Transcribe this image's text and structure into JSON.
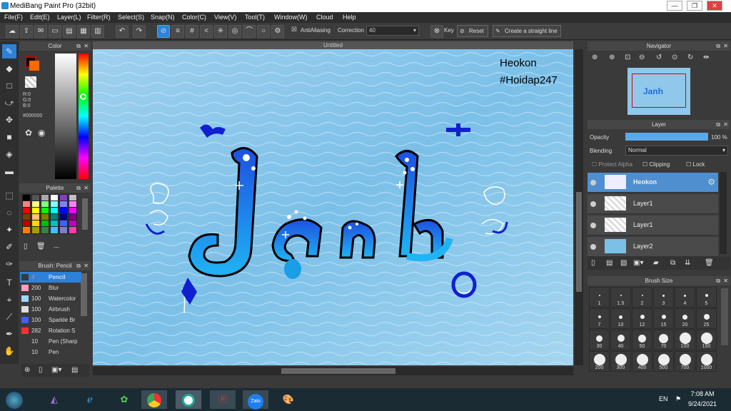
{
  "window": {
    "title": "MediBang Paint Pro (32bit)",
    "min": "—",
    "max": "❐",
    "close": "✕"
  },
  "menu": [
    "File(F)",
    "Edit(E)",
    "Layer(L)",
    "Filter(R)",
    "Select(S)",
    "Snap(N)",
    "Color(C)",
    "View(V)",
    "Tool(T)",
    "Window(W)",
    "Cloud",
    "Help"
  ],
  "toolbar": {
    "antialiasing": "AntiAliasing",
    "correction_label": "Correction",
    "correction_value": "40",
    "key": "Key",
    "reset": "Reset",
    "straight": "Create a straight line"
  },
  "color_panel": {
    "title": "Color",
    "r": "R:0",
    "g": "G:0",
    "b": "B:0",
    "hex": "#000000",
    "fg": "#000000",
    "bg": "#ff6a00"
  },
  "palette_panel": {
    "title": "Palette",
    "colors": [
      "#000000",
      "#555555",
      "#aaaaaa",
      "#ffffff",
      "#8040c0",
      "#c0c0c0",
      "#ff8080",
      "#ffff80",
      "#80ff80",
      "#80ffff",
      "#8080ff",
      "#ff80ff",
      "#ff0000",
      "#ffff00",
      "#00ff00",
      "#00ffff",
      "#0000ff",
      "#ff00ff",
      "#804000",
      "#ffc080",
      "#808000",
      "#008080",
      "#000080",
      "#800080",
      "#c00000",
      "#ffd700",
      "#00c000",
      "#00c0c0",
      "#4060ff",
      "#c000c0",
      "#ff8000",
      "#a0a000",
      "#408040",
      "#40c0ff",
      "#8080c0",
      "#ff40a0"
    ],
    "more": "---"
  },
  "brush_panel": {
    "title": "Brush: Pencil",
    "items": [
      {
        "size": "4",
        "name": "Pencil",
        "color": "#3a3a3a",
        "sel": true
      },
      {
        "size": "200",
        "name": "Blur",
        "color": "#ff9fc0"
      },
      {
        "size": "100",
        "name": "Watercolor",
        "color": "#9fd8ff"
      },
      {
        "size": "100",
        "name": "Airbrush",
        "color": "#dddddd"
      },
      {
        "size": "100",
        "name": "Sparkle Br",
        "color": "#4060ff"
      },
      {
        "size": "282",
        "name": "Rotation S",
        "color": "#ff3030"
      },
      {
        "size": "10",
        "name": "Pen (Sharp",
        "color": "#3a3a3a"
      },
      {
        "size": "10",
        "name": "Pen",
        "color": "#3a3a3a"
      }
    ]
  },
  "canvas": {
    "tab": "Untitled",
    "watermark1": "Heokon",
    "watermark2": "#Hoidap247",
    "art_text": "Janh"
  },
  "navigator": {
    "title": "Navigator"
  },
  "layer_panel": {
    "title": "Layer",
    "opacity_label": "Opacity",
    "opacity_value": "100 %",
    "opacity_fraction": 1.0,
    "blending_label": "Blending",
    "blending_value": "Normal",
    "protect": "Protect Alpha",
    "clipping": "Clipping",
    "lock": "Lock",
    "layers": [
      {
        "name": "Heokon",
        "sel": true
      },
      {
        "name": "Layer1"
      },
      {
        "name": "Layer1"
      },
      {
        "name": "Layer2"
      }
    ]
  },
  "brush_size": {
    "title": "Brush Size",
    "sizes": [
      "1",
      "1.5",
      "2",
      "3",
      "4",
      "5",
      "7",
      "10",
      "12",
      "15",
      "20",
      "25",
      "30",
      "40",
      "50",
      "70",
      "100",
      "150",
      "200",
      "300",
      "400",
      "500",
      "700",
      "1000"
    ]
  },
  "taskbar": {
    "time": "7:08 AM",
    "date": "9/24/2021",
    "lang": "EN"
  }
}
